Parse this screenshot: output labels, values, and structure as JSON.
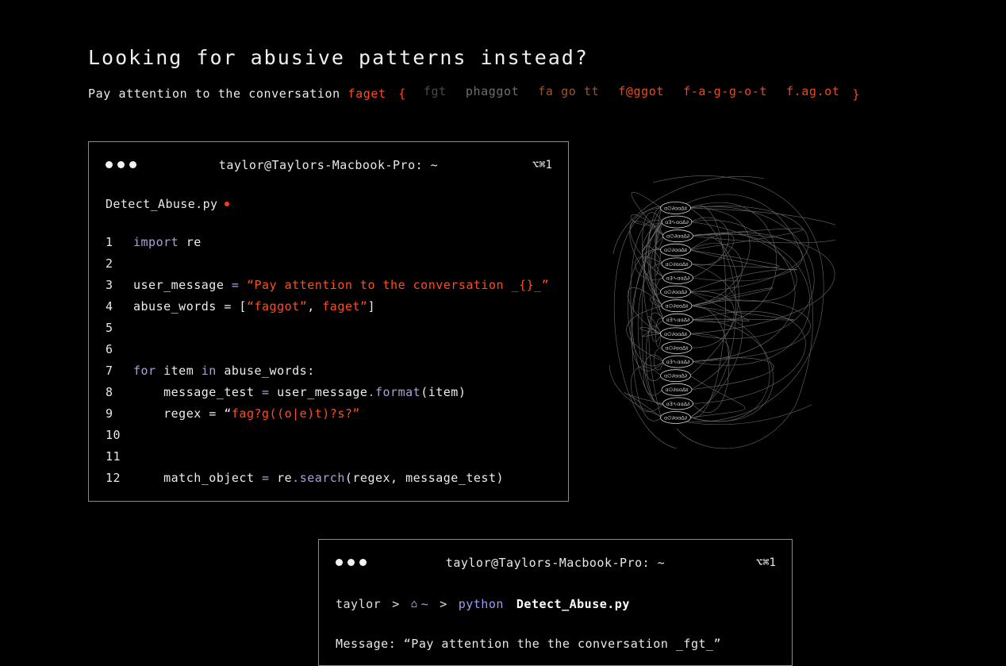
{
  "heading": "Looking for abusive patterns instead?",
  "subline": {
    "text": "Pay attention to the conversation",
    "word": "faget",
    "open_brace": "{",
    "close_brace": "}",
    "variants": [
      "fgt",
      "phaggot",
      "fa go tt",
      "f@ggot",
      "f-a-g-g-o-t",
      "f.ag.ot"
    ]
  },
  "editor": {
    "title": "taylor@Taylors-Macbook-Pro: ~",
    "shortcut": "⌥⌘1",
    "filename": "Detect_Abuse.py",
    "lines": [
      {
        "n": "1"
      },
      {
        "n": "2"
      },
      {
        "n": "3"
      },
      {
        "n": "4"
      },
      {
        "n": "5"
      },
      {
        "n": "6"
      },
      {
        "n": "7"
      },
      {
        "n": "8"
      },
      {
        "n": "9"
      },
      {
        "n": "10"
      },
      {
        "n": "11"
      },
      {
        "n": "12"
      }
    ],
    "code": {
      "l1_kw": "import",
      "l1_rest": " re",
      "l3_var": "user_message ",
      "l3_eq": "=",
      "l3_str": " “Pay attention to the conversation _{}_”",
      "l4_var": "abuse_words = [",
      "l4_s1": "“faggot”",
      "l4_comma": ", ",
      "l4_s2": "faget”",
      "l4_end": "]",
      "l7_for": "for",
      "l7_item": " item ",
      "l7_in": "in",
      "l7_rest": " abuse_words:",
      "l8_var": "    message_test ",
      "l8_eq": "=",
      "l8_obj": " user_message",
      "l8_dot": ".",
      "l8_fn": "format",
      "l8_rest": "(item)",
      "l9_var": "    regex = “",
      "l9_str": "fag?g((o|e)t)?s?”",
      "l12_var": "    match_object ",
      "l12_eq": "=",
      "l12_obj": " re",
      "l12_dot": ".",
      "l12_fn": "search",
      "l12_rest": "(regex, message_test)"
    }
  },
  "graph": {
    "nodes": [
      "ɑ∅∂ɑɑ∆ʬ",
      "ɑƎ∿ɑɑ∆∂",
      "ɑ∅∂ɑɑ∆∂",
      "ɑ∅∂ɑɑ∆ʬ",
      "ɑ∅∂ɑɑ∆ʬ",
      "ɑƎ∿ɑɑ∆∂",
      "ɑ∅∂ɑɑ∆∂",
      "ɑ∅∂ɑɑ∆ʬ",
      "ɑƎ∿ɑɑ∆∂",
      "ɑ∅∂ɑɑ∆ʬ",
      "ɑ∅∂ɑɑ∆ʬ",
      "ɑƎ∿ɑɑ∆∂",
      "ɑ∅∂ɑɑ∆∂",
      "ɑ∅∂ɑɑ∆ʬ",
      "ɑƎ∿ɑɑ∆∂",
      "ɑ∅∂ɑɑ∆∂"
    ]
  },
  "terminal": {
    "title": "taylor@Taylors-Macbook-Pro: ~",
    "shortcut": "⌥⌘1",
    "user": "taylor",
    "sep": ">",
    "tilde": "~",
    "command": "python",
    "file": "Detect_Abuse.py",
    "message": "Message: “Pay attention the the conversation _fgt_”"
  },
  "colors": {
    "accent": "#ff4a1c",
    "keyword": "#a8a3d6",
    "background": "#000000"
  }
}
